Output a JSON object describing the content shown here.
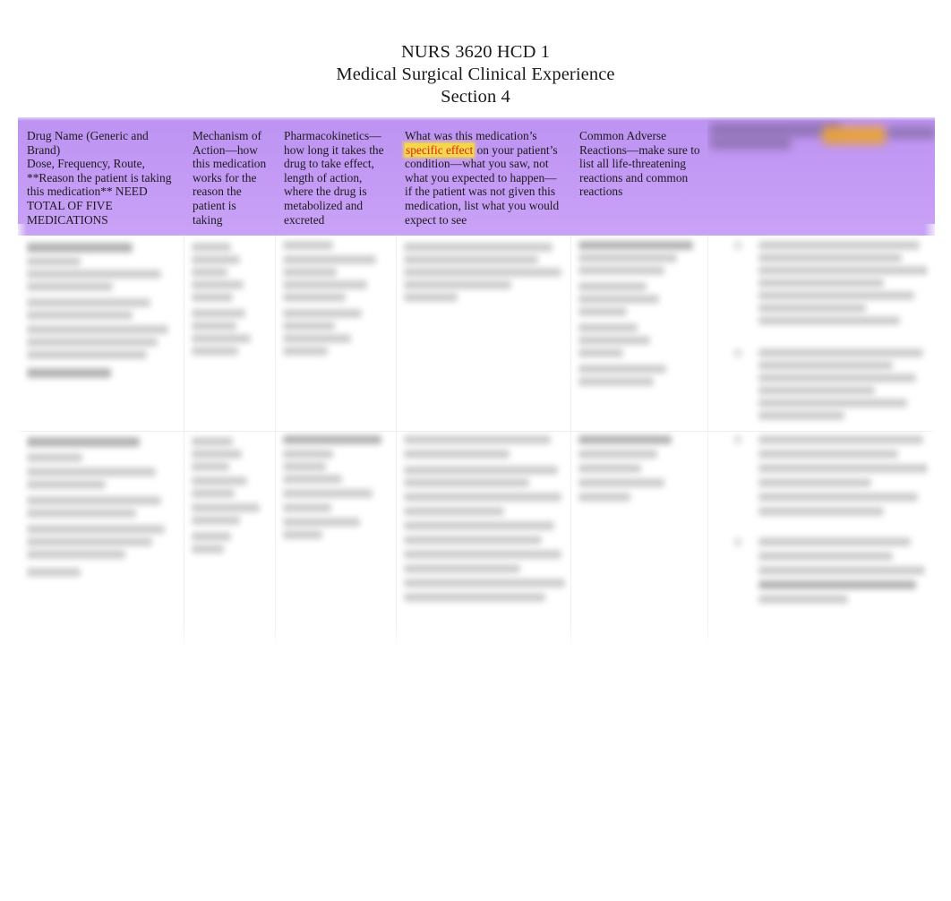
{
  "document": {
    "title_lines": [
      "NURS 3620 HCD 1",
      "Medical Surgical Clinical Experience",
      "Section 4"
    ]
  },
  "theme": {
    "header_purple": "#bd93f2",
    "highlight_yellow": "#f5d84a",
    "highlight_text_red": "#e02418",
    "redaction_orange": "#e8a33c",
    "page_background": "#ffffff",
    "body_text": "#1d1a1d"
  },
  "table": {
    "columns": [
      {
        "key": "drug_name",
        "header_paragraphs": [
          "Drug Name (Generic and Brand)",
          "Dose, Frequency, Route, **Reason the patient is taking this medication** NEED TOTAL OF FIVE MEDICATIONS"
        ],
        "redacted": false
      },
      {
        "key": "mechanism_of_action",
        "header_paragraphs": [
          "Mechanism of Action—how this medication works for the reason the patient is taking"
        ],
        "redacted": false
      },
      {
        "key": "pharmacokinetics",
        "header_paragraphs": [
          "Pharmacokinetics—how long it takes the drug to take effect, length of action, where the drug is metabolized and excreted"
        ],
        "redacted": false
      },
      {
        "key": "specific_effect",
        "header_prefix": "What was this medication’s ",
        "header_highlight": "specific effect",
        "header_suffix": " on your patient’s condition—what you saw, not what you expected to happen—if the patient was not given this medication, list what you would expect to see",
        "redacted": false
      },
      {
        "key": "adverse_reactions",
        "header_paragraphs": [
          "Common Adverse Reactions—make sure to list all life-threatening reactions and common reactions"
        ],
        "redacted": false
      },
      {
        "key": "nursing_considerations",
        "header_paragraphs": [
          ""
        ],
        "redacted": true,
        "redaction_note": "blurred header text with orange highlight"
      }
    ],
    "rows": [
      {
        "row_label": "medication-row-1",
        "cells": [
          {
            "column": "drug_name",
            "redacted": true
          },
          {
            "column": "mechanism_of_action",
            "redacted": true
          },
          {
            "column": "pharmacokinetics",
            "redacted": true
          },
          {
            "column": "specific_effect",
            "redacted": true
          },
          {
            "column": "adverse_reactions",
            "redacted": true
          },
          {
            "column": "nursing_considerations",
            "redacted": true
          }
        ]
      },
      {
        "row_label": "medication-row-2",
        "cells": [
          {
            "column": "drug_name",
            "redacted": true
          },
          {
            "column": "mechanism_of_action",
            "redacted": true
          },
          {
            "column": "pharmacokinetics",
            "redacted": true
          },
          {
            "column": "specific_effect",
            "redacted": true
          },
          {
            "column": "adverse_reactions",
            "redacted": true
          },
          {
            "column": "nursing_considerations",
            "redacted": true
          }
        ]
      }
    ]
  }
}
